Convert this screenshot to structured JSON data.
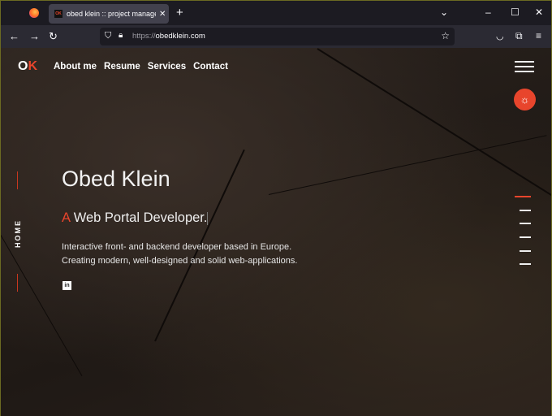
{
  "browser": {
    "tab_title": "obed klein :: project manager | f",
    "tab_favicon": "OK",
    "url_scheme": "https://",
    "url_host": "obedklein.com"
  },
  "site": {
    "logo_o": "O",
    "logo_k": "K",
    "nav": [
      "About me",
      "Resume",
      "Services",
      "Contact"
    ],
    "side_label": "HOME",
    "name": "Obed Klein",
    "subtitle_a": "A",
    "subtitle_rest": " Web Portal Developer.",
    "desc_line1": "Interactive front- and backend developer based in Europe.",
    "desc_line2": "Creating modern, well-designed and solid web-applications.",
    "linkedin": "in",
    "accent": "#e8452c",
    "section_dots": 6,
    "active_dot": 0
  }
}
